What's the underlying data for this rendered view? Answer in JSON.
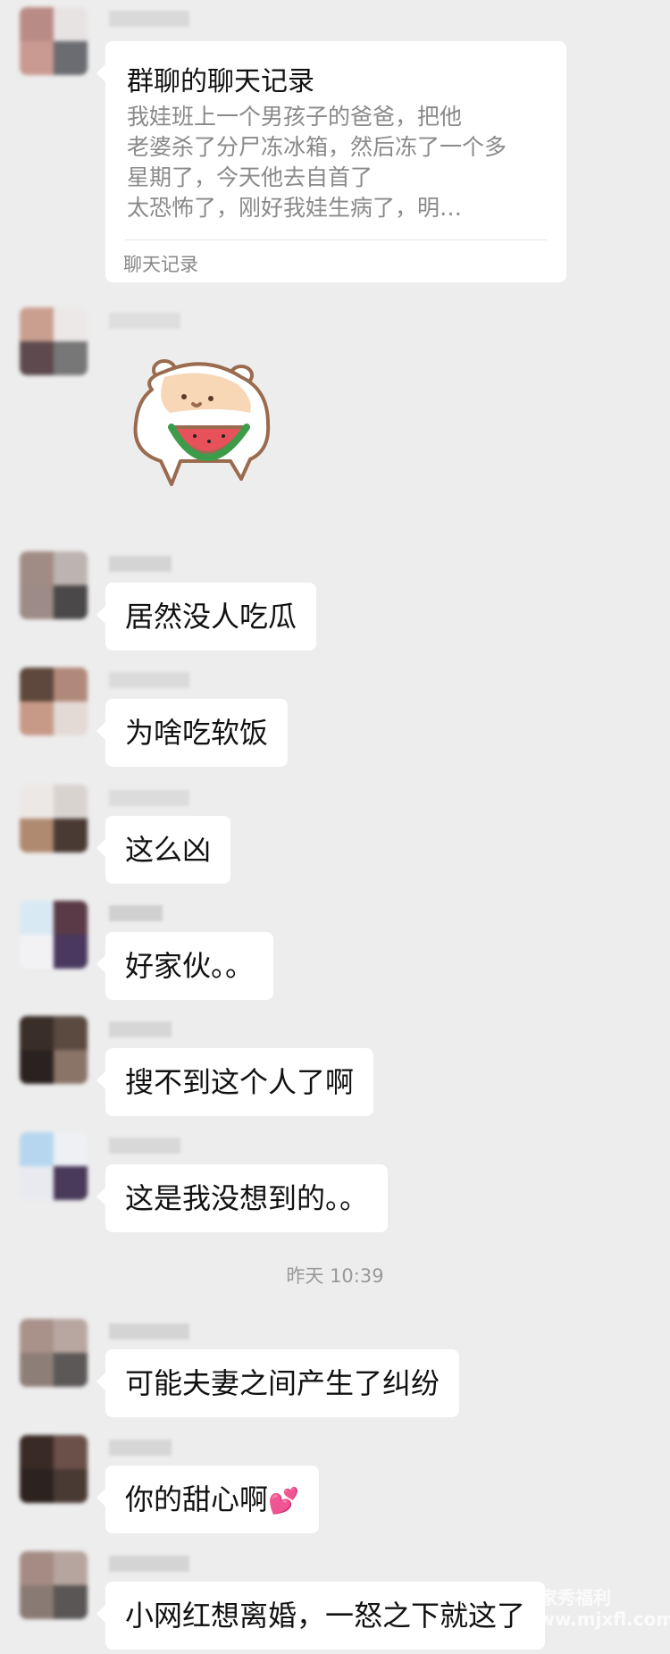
{
  "colors": {
    "background": "#ededed",
    "bubble": "#ffffff",
    "text": "#111111",
    "muted": "#888888"
  },
  "chat_record_card": {
    "title": "群聊的聊天记录",
    "lines": [
      "我娃班上一个男孩子的爸爸，把他",
      "老婆杀了分尸冻冰箱，然后冻了一个多",
      "星期了，今天他去自首了",
      "太恐怖了，刚好我娃生病了，明…"
    ],
    "footer": "聊天记录"
  },
  "sticker": {
    "icon": "hamster-eating-watermelon-sticker"
  },
  "messages": [
    {
      "text": "居然没人吃瓜"
    },
    {
      "text": "为啥吃软饭"
    },
    {
      "text": "这么凶"
    },
    {
      "text": "好家伙。。"
    },
    {
      "text": "搜不到这个人了啊"
    },
    {
      "text": "这是我没想到的。。"
    },
    {
      "text": "可能夫妻之间产生了纠纷"
    },
    {
      "text": "你的甜心啊",
      "emoji": "💕"
    },
    {
      "text": "小网红想离婚，一怒之下就这了"
    }
  ],
  "timestamp": "昨天 10:39",
  "watermark": {
    "line1": "买家秀福利",
    "line2": "www.mjxfl.com"
  }
}
